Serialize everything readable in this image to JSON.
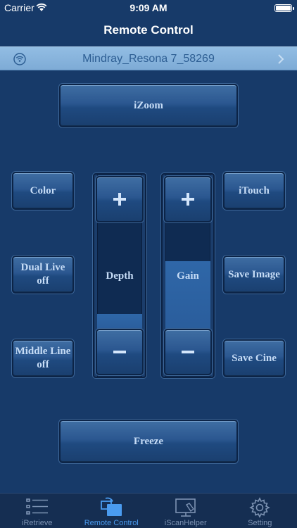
{
  "status_bar": {
    "carrier": "Carrier",
    "time": "9:09 AM"
  },
  "nav": {
    "title": "Remote Control"
  },
  "device": {
    "name": "Mindray_Resona 7_58269"
  },
  "controls": {
    "izoom": "iZoom",
    "color": "Color",
    "dual_live_line1": "Dual Live",
    "dual_live_line2": "off",
    "middle_line_line1": "Middle Line",
    "middle_line_line2": "off",
    "itouch": "iTouch",
    "save_image": "Save Image",
    "save_cine": "Save Cine",
    "freeze": "Freeze"
  },
  "sliders": {
    "depth": {
      "label": "Depth",
      "level": 0.15
    },
    "gain": {
      "label": "Gain",
      "level": 0.63
    }
  },
  "tabs": [
    {
      "label": "iRetrieve",
      "icon": "list-icon",
      "active": false
    },
    {
      "label": "Remote Control",
      "icon": "remote-icon",
      "active": true
    },
    {
      "label": "iScanHelper",
      "icon": "scan-helper-icon",
      "active": false
    },
    {
      "label": "Setting",
      "icon": "gear-icon",
      "active": false
    }
  ],
  "colors": {
    "background": "#173a69",
    "accent": "#4a9bef",
    "device_bar": "#8bb7e0"
  }
}
